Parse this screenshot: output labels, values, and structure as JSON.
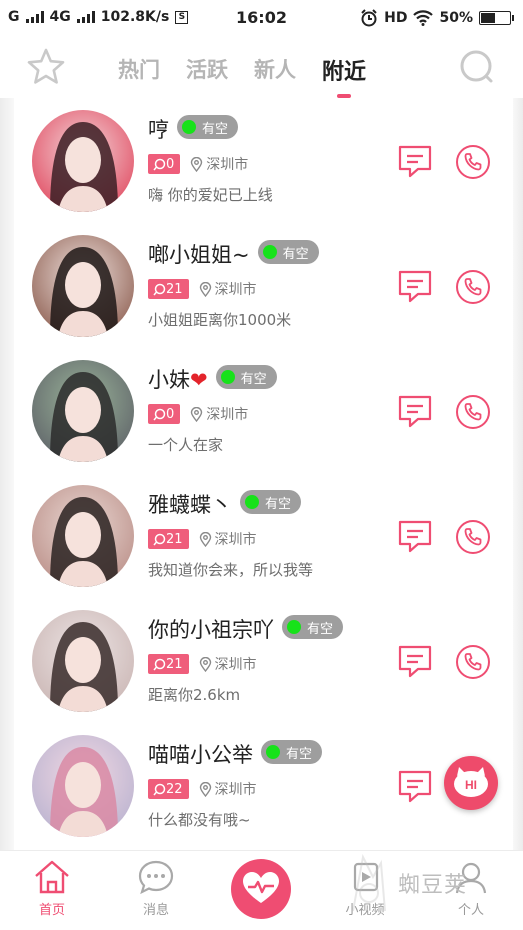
{
  "status_bar": {
    "carrier1": "G",
    "carrier2": "4G",
    "speed": "102.8K/s",
    "speed_icon": "S",
    "time": "16:02",
    "hd": "HD",
    "battery": "50%",
    "battery_level": 0.5
  },
  "top_nav": {
    "tabs": [
      {
        "label": "热门",
        "active": false
      },
      {
        "label": "活跃",
        "active": false
      },
      {
        "label": "新人",
        "active": false
      },
      {
        "label": "附近",
        "active": true
      }
    ]
  },
  "users": [
    {
      "name": "哼",
      "status": "有空",
      "count": "0",
      "location": "深圳市",
      "bio": "嗨 你的爱妃已上线",
      "avatar_colors": [
        "#f3d6d9",
        "#e0455c",
        "#3b1f25"
      ]
    },
    {
      "name": "啷小姐姐~",
      "status": "有空",
      "count": "21",
      "location": "深圳市",
      "bio": "小姐姐距离你1000米",
      "avatar_colors": [
        "#f0e2de",
        "#8a5a4c",
        "#1f1816"
      ]
    },
    {
      "name": "小妹",
      "heart": "❤",
      "status": "有空",
      "count": "0",
      "location": "深圳市",
      "bio": "一个人在家",
      "avatar_colors": [
        "#9bb59a",
        "#5c5f66",
        "#2b2b2b"
      ]
    },
    {
      "name": "雅蠛蝶丶",
      "status": "有空",
      "count": "21",
      "location": "深圳市",
      "bio": "我知道你会来，所以我等",
      "avatar_colors": [
        "#ead8d3",
        "#b98d86",
        "#2a2221"
      ]
    },
    {
      "name": "你的小祖宗吖",
      "status": "有空",
      "count": "21",
      "location": "深圳市",
      "bio": "距离你2.6km",
      "avatar_colors": [
        "#ece4e4",
        "#c9b4b2",
        "#3a2d2c"
      ]
    },
    {
      "name": "喵喵小公举",
      "status": "有空",
      "count": "22",
      "location": "深圳市",
      "bio": "什么都没有哦~",
      "avatar_colors": [
        "#f2d9e3",
        "#b7b1cf",
        "#d98aa5"
      ]
    }
  ],
  "floating": {
    "label": "HI"
  },
  "bottom_nav": {
    "items": [
      {
        "label": "首页",
        "icon": "home-icon",
        "active": true
      },
      {
        "label": "消息",
        "icon": "chat-bubble-icon",
        "active": false
      },
      {
        "label": "小视频",
        "icon": "video-icon",
        "active": false
      },
      {
        "label": "个人",
        "icon": "person-icon",
        "active": false
      }
    ]
  },
  "watermark": {
    "text": "蜘豆荚"
  },
  "colors": {
    "accent": "#ef4d72",
    "online": "#17e21a",
    "status_bg": "#9e9e9e"
  }
}
